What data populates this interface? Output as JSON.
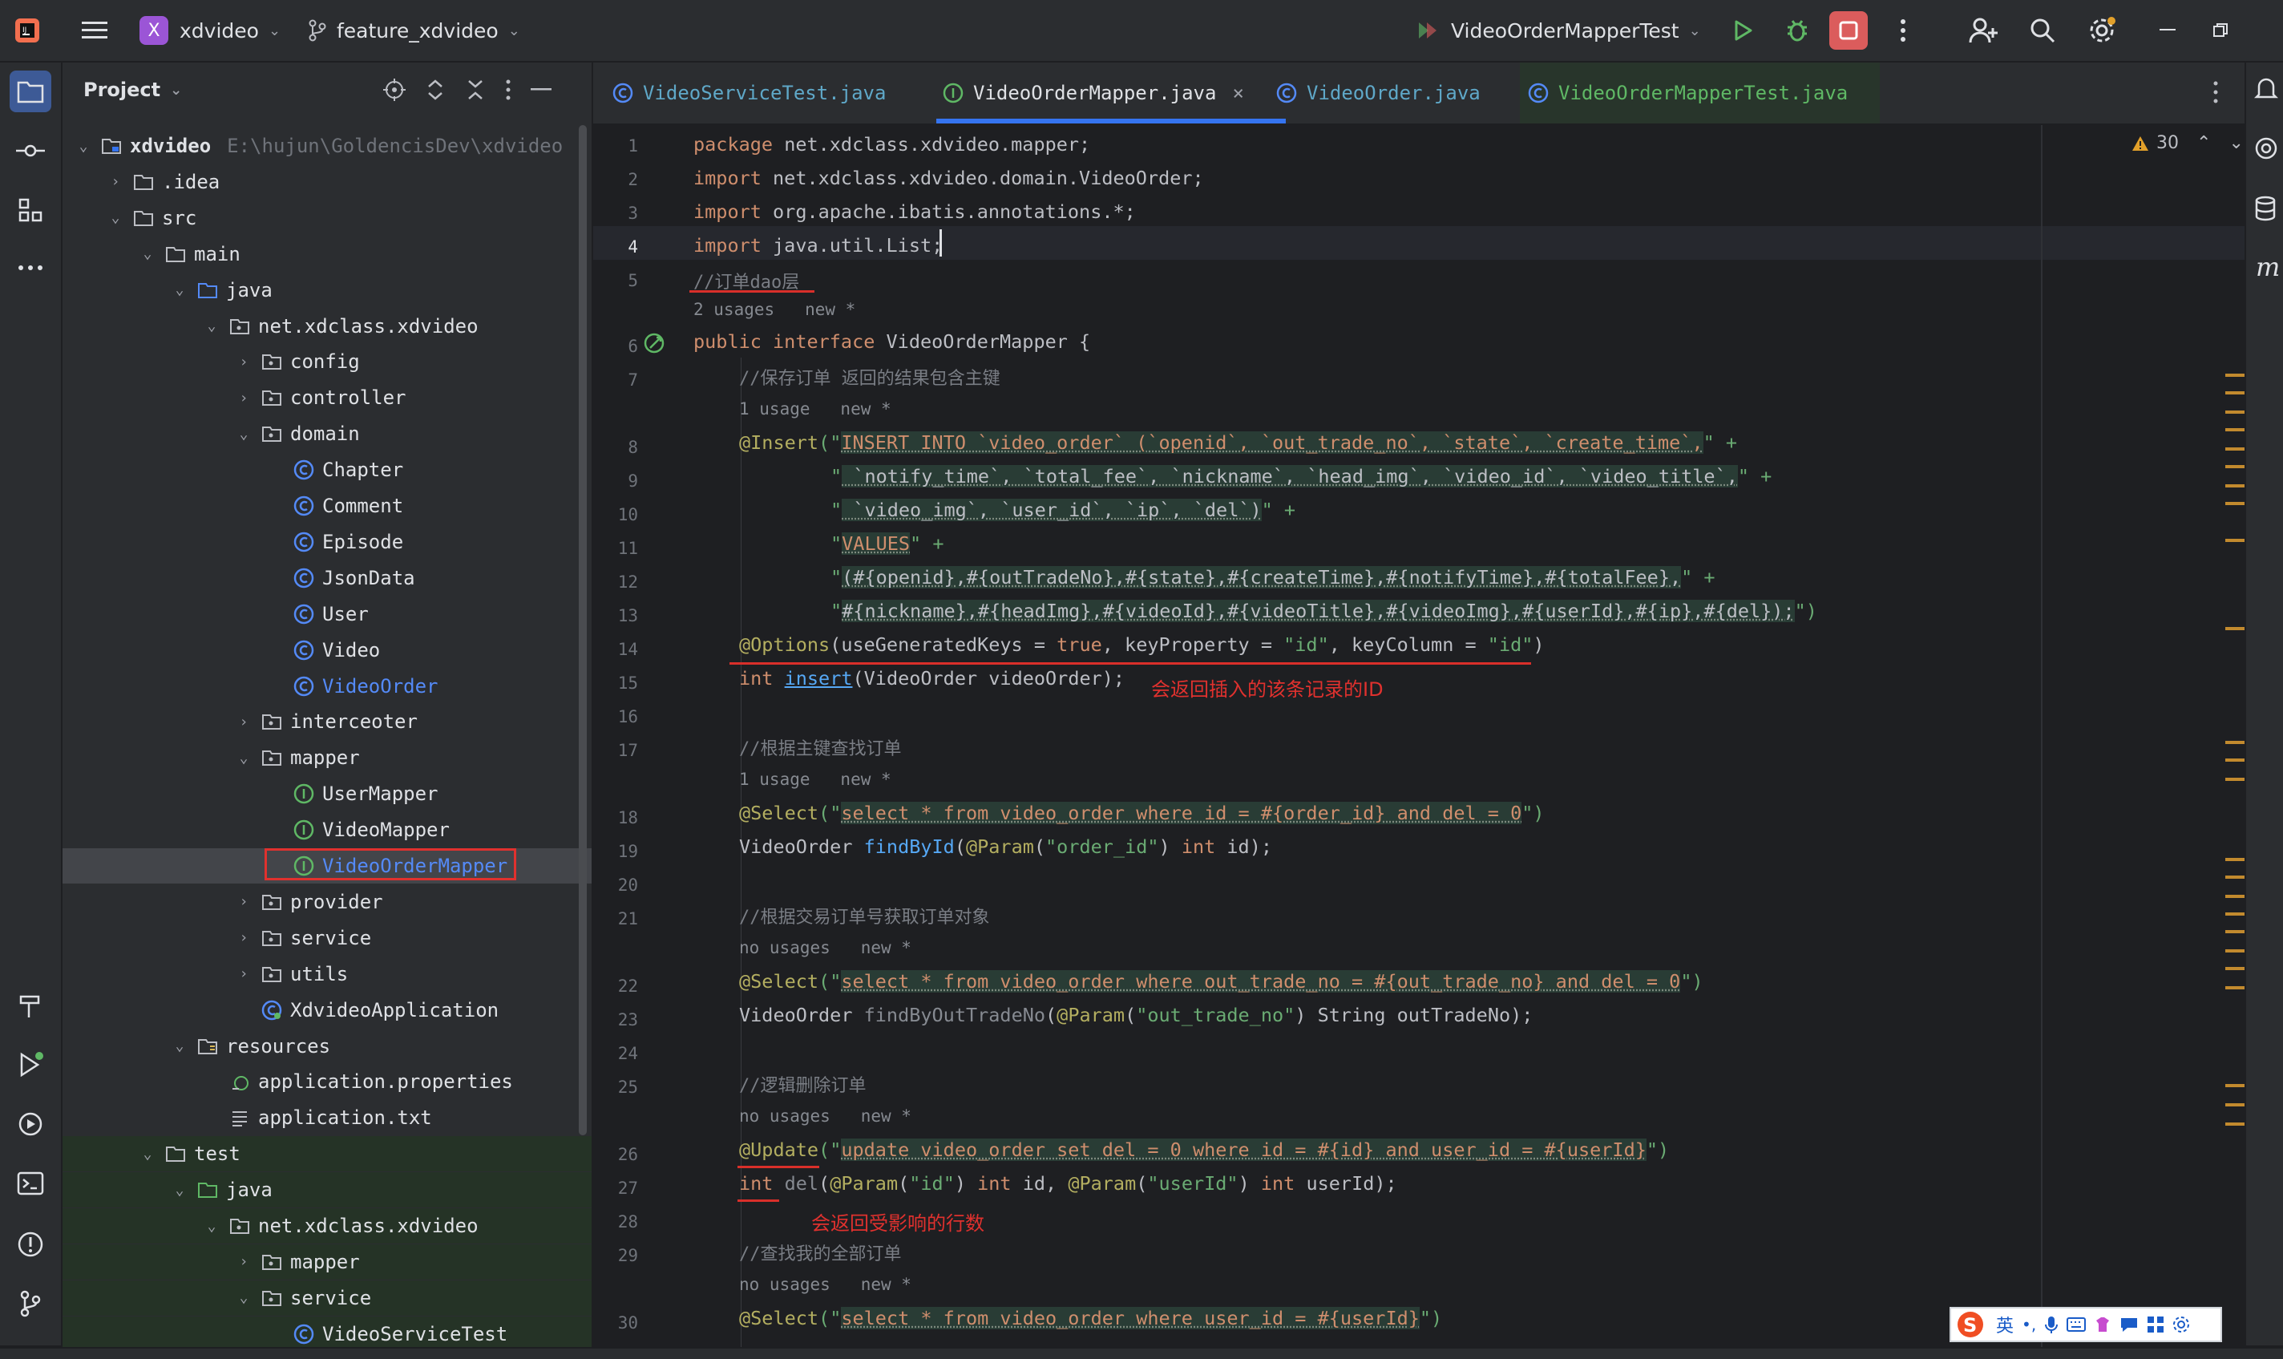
{
  "titlebar": {
    "project_initial": "X",
    "project_name": "xdvideo",
    "branch": "feature_xdvideo",
    "run_config": "VideoOrderMapperTest"
  },
  "project_panel": {
    "title": "Project",
    "root_name": "xdvideo",
    "root_path": "E:\\hujun\\GoldencisDev\\xdvideo",
    "items": [
      {
        "label": "xdvideo"
      },
      {
        "label": ".idea"
      },
      {
        "label": "src"
      },
      {
        "label": "main"
      },
      {
        "label": "java"
      },
      {
        "label": "net.xdclass.xdvideo"
      },
      {
        "label": "config"
      },
      {
        "label": "controller"
      },
      {
        "label": "domain"
      },
      {
        "label": "Chapter"
      },
      {
        "label": "Comment"
      },
      {
        "label": "Episode"
      },
      {
        "label": "JsonData"
      },
      {
        "label": "User"
      },
      {
        "label": "Video"
      },
      {
        "label": "VideoOrder"
      },
      {
        "label": "interceoter"
      },
      {
        "label": "mapper"
      },
      {
        "label": "UserMapper"
      },
      {
        "label": "VideoMapper"
      },
      {
        "label": "VideoOrderMapper"
      },
      {
        "label": "provider"
      },
      {
        "label": "service"
      },
      {
        "label": "utils"
      },
      {
        "label": "XdvideoApplication"
      },
      {
        "label": "resources"
      },
      {
        "label": "application.properties"
      },
      {
        "label": "application.txt"
      },
      {
        "label": "test"
      },
      {
        "label": "java"
      },
      {
        "label": "net.xdclass.xdvideo"
      },
      {
        "label": "mapper"
      },
      {
        "label": "service"
      },
      {
        "label": "VideoServiceTest"
      }
    ]
  },
  "tabs": [
    {
      "label": "VideoServiceTest.java"
    },
    {
      "label": "VideoOrderMapper.java"
    },
    {
      "label": "VideoOrder.java"
    },
    {
      "label": "VideoOrderMapperTest.java"
    }
  ],
  "editor": {
    "warning_count": "30",
    "line_numbers": [
      "1",
      "2",
      "3",
      "4",
      "5",
      "6",
      "7",
      "8",
      "9",
      "10",
      "11",
      "12",
      "13",
      "14",
      "15",
      "16",
      "17",
      "18",
      "19",
      "20",
      "21",
      "22",
      "23",
      "24",
      "25",
      "26",
      "27",
      "28",
      "29",
      "30"
    ],
    "lines": {
      "l1_kw": "package",
      "l1_rest": " net.xdclass.xdvideo.mapper;",
      "l2_kw": "import",
      "l2_rest": " net.xdclass.xdvideo.domain.VideoOrder;",
      "l3_kw": "import",
      "l3_rest": " org.apache.ibatis.annotations.*;",
      "l4_kw": "import",
      "l4_rest": " java.util.List;",
      "l5": "//订单dao层",
      "hint_2usages": "2 usages   new *",
      "l6_kw": "public interface",
      "l6_rest": " VideoOrderMapper {",
      "l7": "//保存订单 返回的结果包含主键",
      "hint_1usage_a": "1 usage   new *",
      "l8_ann": "@Insert",
      "l8_q1": "(\"",
      "l8_sql": "INSERT INTO `video_order` (`openid`, `out_trade_no`, `state`, `create_time`,",
      "l8_end": "\" +",
      "l9_q": "\"",
      "l9_sql": " `notify_time`, `total_fee`, `nickname`, `head_img`, `video_id`, `video_title`,",
      "l9_end": "\" +",
      "l10_q": "\"",
      "l10_sql": " `video_img`, `user_id`, `ip`, `del`)",
      "l10_end": "\" +",
      "l11_q": "\"",
      "l11_sql": "VALUES",
      "l11_end": "\" +",
      "l12_q": "\"",
      "l12_sql": "(#{openid},#{outTradeNo},#{state},#{createTime},#{notifyTime},#{totalFee},",
      "l12_end": "\" +",
      "l13_q": "\"",
      "l13_sql": "#{nickname},#{headImg},#{videoId},#{videoTitle},#{videoImg},#{userId},#{ip},#{del});",
      "l13_end": "\")",
      "l14_ann": "@Options",
      "l14_a": "(useGeneratedKeys = ",
      "l14_true": "true",
      "l14_b": ", keyProperty = ",
      "l14_s1": "\"id\"",
      "l14_c": ", keyColumn = ",
      "l14_s2": "\"id\"",
      "l14_d": ")",
      "l15_kw": "int",
      "l15_fn": "insert",
      "l15_rest": "(VideoOrder videoOrder);",
      "note1": "会返回插入的该条记录的ID",
      "l17": "//根据主键查找订单",
      "hint_1usage_b": "1 usage   new *",
      "l18_ann": "@Select",
      "l18_q1": "(\"",
      "l18_sql": "select * from video_order where id = #{order_id} and del = 0",
      "l18_end": "\")",
      "l19_a": "VideoOrder ",
      "l19_fn": "findById",
      "l19_b": "(",
      "l19_ann": "@Param",
      "l19_c": "(",
      "l19_s": "\"order_id\"",
      "l19_d": ") ",
      "l19_kw": "int",
      "l19_e": " id);",
      "l21": "//根据交易订单号获取订单对象",
      "hint_nousage_a": "no usages   new *",
      "l22_ann": "@Select",
      "l22_q1": "(\"",
      "l22_sql": "select * from video_order where out_trade_no = #{out_trade_no} and del = 0",
      "l22_end": "\")",
      "l23_a": "VideoOrder ",
      "l23_fn": "findByOutTradeNo",
      "l23_b": "(",
      "l23_ann": "@Param",
      "l23_c": "(",
      "l23_s": "\"out_trade_no\"",
      "l23_d": ") String outTradeNo);",
      "l25": "//逻辑删除订单",
      "hint_nousage_b": "no usages   new *",
      "l26_ann": "@Update",
      "l26_q1": "(\"",
      "l26_sql": "update video_order set del = 0 where id = #{id} and user_id = #{userId}",
      "l26_end": "\")",
      "l27_kw": "int",
      "l27_fn": " del",
      "l27_b": "(",
      "l27_ann1": "@Param",
      "l27_c": "(",
      "l27_s1": "\"id\"",
      "l27_d": ") ",
      "l27_kw2": "int",
      "l27_e": " id, ",
      "l27_ann2": "@Param",
      "l27_f": "(",
      "l27_s2": "\"userId\"",
      "l27_g": ") ",
      "l27_kw3": "int",
      "l27_h": " userId);",
      "note2": "会返回受影响的行数",
      "l29": "//查找我的全部订单",
      "hint_nousage_c": "no usages   new *",
      "l30_ann": "@Select",
      "l30_q1": "(\"",
      "l30_sql": "select * from video_order where user_id = #{userId}",
      "l30_end": "\")"
    }
  },
  "ime": {
    "lang": "英"
  },
  "colors": {
    "accent": "#3574f0",
    "highlight_box": "#e0312e",
    "keyword": "#cf8e6d",
    "annotation": "#b3ae60",
    "string": "#6aab73",
    "run_green": "#5fb865",
    "stop_red": "#db5c5c"
  }
}
